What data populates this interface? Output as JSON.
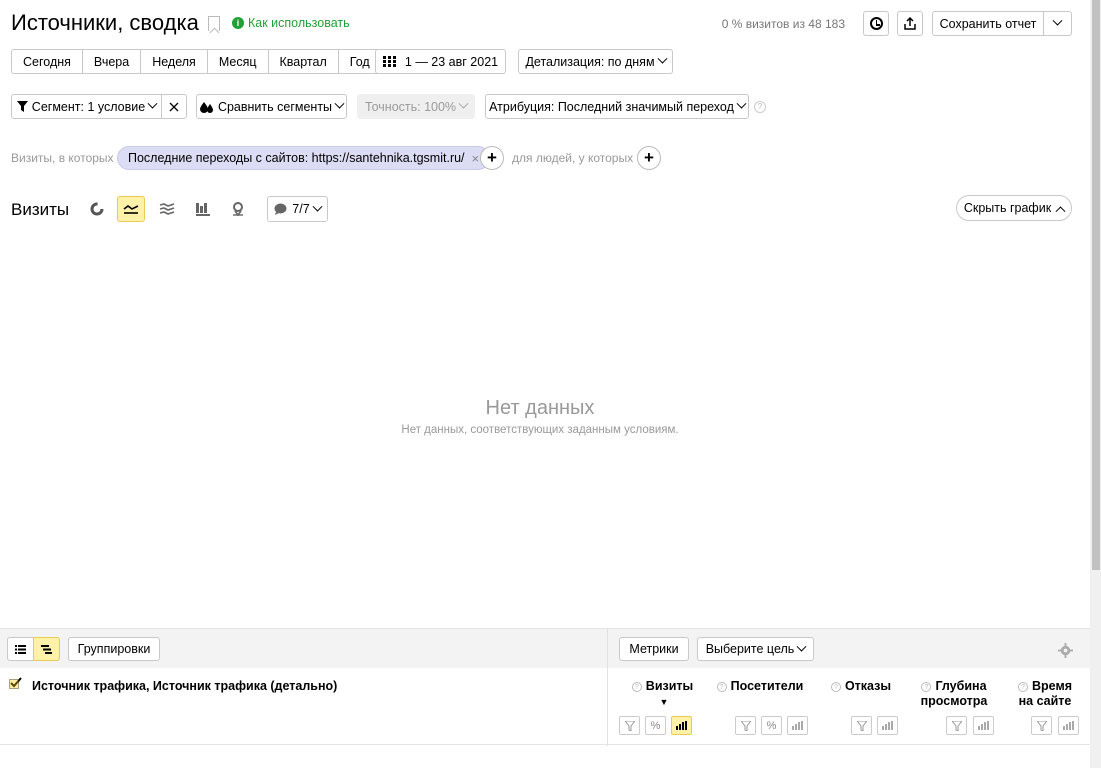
{
  "header": {
    "title": "Источники, сводка",
    "howto_label": "Как использовать",
    "visits_share": "0 % визитов из 48 183",
    "save_report": "Сохранить отчет"
  },
  "periods": [
    "Сегодня",
    "Вчера",
    "Неделя",
    "Месяц",
    "Квартал",
    "Год"
  ],
  "date_range": "1 — 23 авг 2021",
  "detail": "Детализация: по дням",
  "segment": {
    "label": "Сегмент: 1 условие",
    "compare": "Сравнить сегменты",
    "accuracy": "Точность: 100%",
    "attribution": "Атрибуция: Последний значимый переход"
  },
  "filters": {
    "prefix": "Визиты, в которых",
    "pill": "Последние переходы с сайтов: https://santehnika.tgsmit.ru/",
    "people": "для людей, у которых"
  },
  "chart": {
    "title": "Визиты",
    "series_count": "7/7",
    "hide_chart": "Скрыть график",
    "no_data": "Нет данных",
    "no_data_sub": "Нет данных, соответствующих заданным условиям."
  },
  "table": {
    "groupings": "Группировки",
    "metrics": "Метрики",
    "goal": "Выберите цель",
    "dimension": "Источник трафика, Источник трафика (детально)",
    "columns": {
      "visits": "Визиты",
      "visitors": "Посетители",
      "bounces": "Отказы",
      "depth1": "Глубина",
      "depth2": "просмотра",
      "time1": "Время",
      "time2": "на сайте"
    }
  }
}
